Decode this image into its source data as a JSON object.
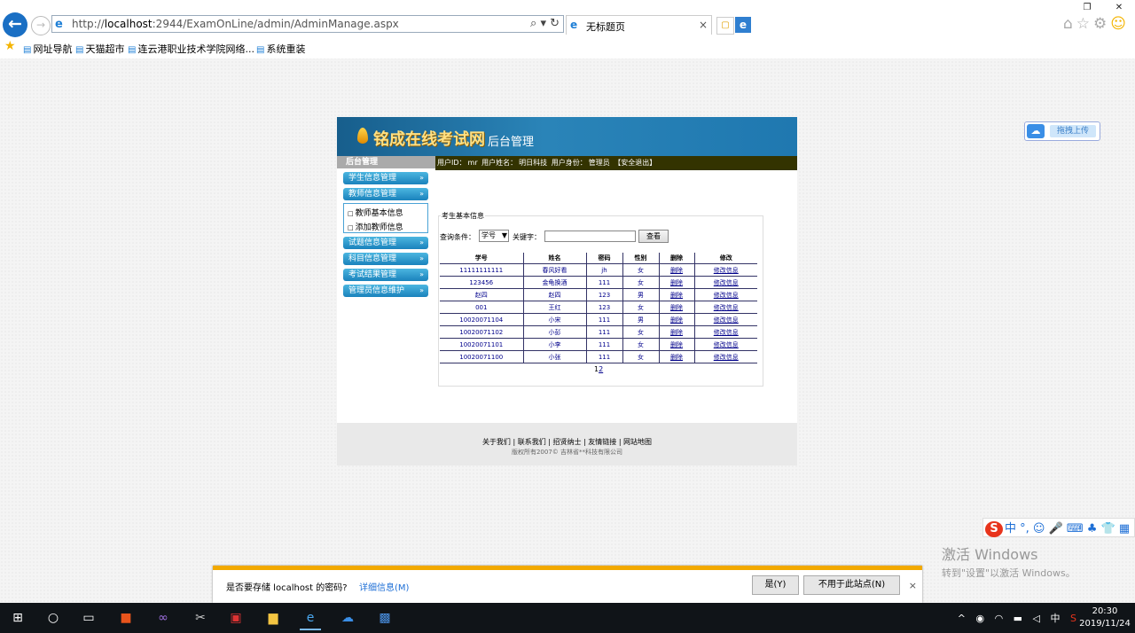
{
  "browser": {
    "url_prefix": "http://",
    "url_host": "localhost",
    "url_rest": ":2944/ExamOnLine/admin/AdminManage.aspx",
    "tab_title": "无标题页",
    "favorites": [
      "网址导航",
      "天猫超市",
      "连云港职业技术学院网络...",
      "系统重装"
    ]
  },
  "site": {
    "logo": "铭成在线考试网",
    "logo_sub": "后台管理",
    "menu_title": "后台管理",
    "user_bar": {
      "id_label": "用户ID：",
      "id_value": "mr",
      "name_label": "用户姓名：",
      "name_value": "明日科技",
      "role_label": "用户身份：",
      "role_value": "管理员",
      "logout": "【安全退出】"
    },
    "menu": [
      "学生信息管理",
      "教师信息管理",
      "试题信息管理",
      "科目信息管理",
      "考试结果管理",
      "管理员信息维护"
    ],
    "submenu": [
      "教师基本信息",
      "添加教师信息"
    ],
    "panel_legend": "考生基本信息",
    "query_label": "查询条件：",
    "query_select": "学号",
    "keyword_label": "关键字：",
    "keyword_value": "",
    "search_button": "查看",
    "table": {
      "headers": [
        "学号",
        "姓名",
        "密码",
        "性别",
        "删除",
        "修改"
      ],
      "rows": [
        [
          "11111111111",
          "春风好看",
          "jh",
          "女",
          "删除",
          "修改信息"
        ],
        [
          "123456",
          "金龟换酒",
          "111",
          "女",
          "删除",
          "修改信息"
        ],
        [
          "赵四",
          "赵四",
          "123",
          "男",
          "删除",
          "修改信息"
        ],
        [
          "001",
          "王红",
          "123",
          "女",
          "删除",
          "修改信息"
        ],
        [
          "10020071104",
          "小宋",
          "111",
          "男",
          "删除",
          "修改信息"
        ],
        [
          "10020071102",
          "小彭",
          "111",
          "女",
          "删除",
          "修改信息"
        ],
        [
          "10020071101",
          "小李",
          "111",
          "女",
          "删除",
          "修改信息"
        ],
        [
          "10020071100",
          "小张",
          "111",
          "女",
          "删除",
          "修改信息"
        ]
      ]
    },
    "pager": [
      "1",
      "2"
    ],
    "footer_links": "关于我们 | 联系我们 | 招贤纳士 | 友情链接 | 网站地图",
    "footer_copy": "版权所有2007© 吉林省**科技有限公司"
  },
  "upload_widget": "拖拽上传",
  "activation": {
    "line1": "激活 Windows",
    "line2": "转到\"设置\"以激活 Windows。"
  },
  "password_prompt": {
    "question": "是否要存储 localhost 的密码?",
    "details": "详细信息(M)",
    "yes": "是(Y)",
    "never": "不用于此站点(N)"
  },
  "ime": "中",
  "clock": {
    "time": "20:30",
    "date": "2019/11/24"
  },
  "tray_lang": "中",
  "colors": {
    "banner": "#2a84b8",
    "user_bar": "#333300",
    "menu_button": "#1a82bc",
    "link": "#00008b",
    "prompt_accent": "#f2a900"
  }
}
